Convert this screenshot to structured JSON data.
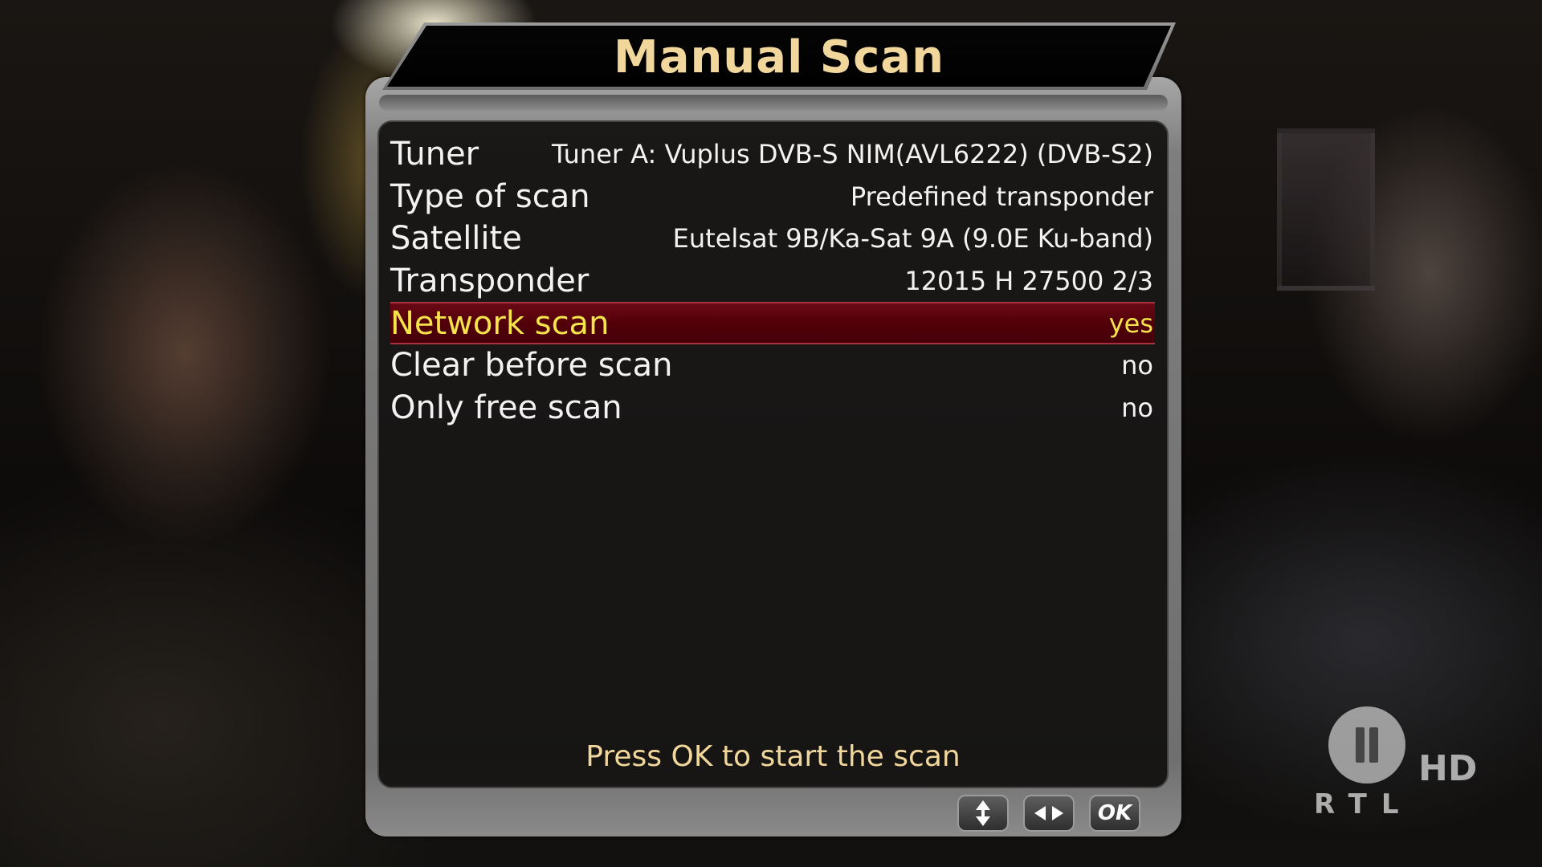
{
  "window": {
    "title": "Manual Scan"
  },
  "settings": [
    {
      "label": "Tuner",
      "value": "Tuner A: Vuplus DVB-S NIM(AVL6222) (DVB-S2)",
      "selected": false
    },
    {
      "label": "Type of scan",
      "value": "Predefined transponder",
      "selected": false
    },
    {
      "label": "Satellite",
      "value": "Eutelsat 9B/Ka-Sat 9A (9.0E Ku-band)",
      "selected": false
    },
    {
      "label": "Transponder",
      "value": "12015 H 27500 2/3",
      "selected": false
    },
    {
      "label": "Network scan",
      "value": "yes",
      "selected": true
    },
    {
      "label": "Clear before scan",
      "value": "no",
      "selected": false
    },
    {
      "label": "Only free scan",
      "value": "no",
      "selected": false
    }
  ],
  "hint": "Press OK to start the scan",
  "keys": {
    "updown_icon": "up-down-arrows-icon",
    "leftright_icon": "left-right-arrows-icon",
    "ok_label": "OK"
  },
  "channel_logo": {
    "pause_icon": "pause-icon",
    "hd": "HD",
    "name": "RTL"
  },
  "colors": {
    "title": "#f1d79c",
    "selected_text": "#f4e34a",
    "selected_bg": "#520008",
    "text": "#f2f2f2"
  }
}
